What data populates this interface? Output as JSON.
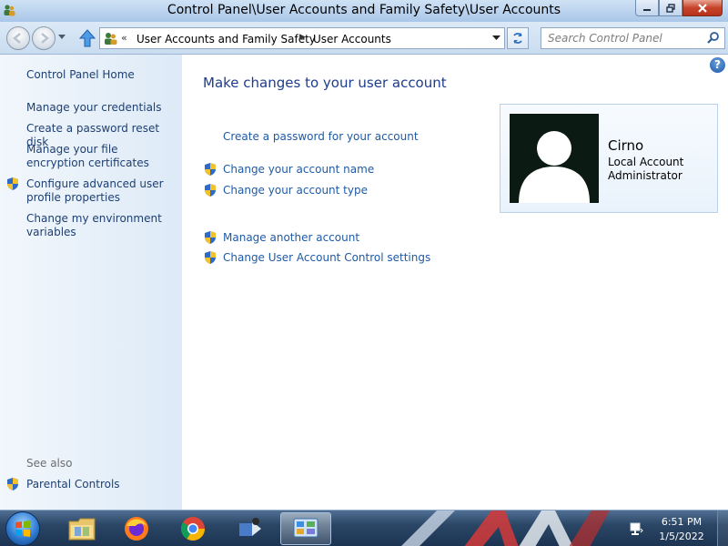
{
  "window": {
    "title": "Control Panel\\User Accounts and Family Safety\\User Accounts"
  },
  "address": {
    "chevron": "«",
    "segment1": "User Accounts and Family Safety",
    "segment2": "User Accounts"
  },
  "search": {
    "placeholder": "Search Control Panel"
  },
  "sidebar": {
    "home": "Control Panel Home",
    "links": [
      {
        "label": "Manage your credentials",
        "shield": false
      },
      {
        "label": "Create a password reset disk",
        "shield": false
      },
      {
        "label": "Manage your file encryption certificates",
        "shield": false
      },
      {
        "label": "Configure advanced user profile properties",
        "shield": true
      },
      {
        "label": "Change my environment variables",
        "shield": false
      }
    ],
    "see_also_label": "See also",
    "see_also": [
      {
        "label": "Parental Controls",
        "shield": true
      }
    ]
  },
  "main": {
    "heading": "Make changes to your user account",
    "tasks": [
      {
        "label": "Create a password for your account",
        "shield": false
      },
      {
        "label": "Change your account name",
        "shield": true
      },
      {
        "label": "Change your account type",
        "shield": true
      },
      {
        "label": "Manage another account",
        "shield": true
      },
      {
        "label": "Change User Account Control settings",
        "shield": true
      }
    ],
    "help_glyph": "?"
  },
  "account": {
    "name": "Cirno",
    "type": "Local Account",
    "role": "Administrator"
  },
  "taskbar": {
    "items": [
      "start-orb",
      "explorer-icon",
      "firefox-icon",
      "chrome-icon",
      "app-icon",
      "control-panel-icon"
    ],
    "time": "6:51 PM",
    "date": "1/5/2022"
  },
  "colors": {
    "link": "#1e5aa8",
    "heading": "#1e3c8c",
    "sidebar_link": "#1e3f72"
  }
}
